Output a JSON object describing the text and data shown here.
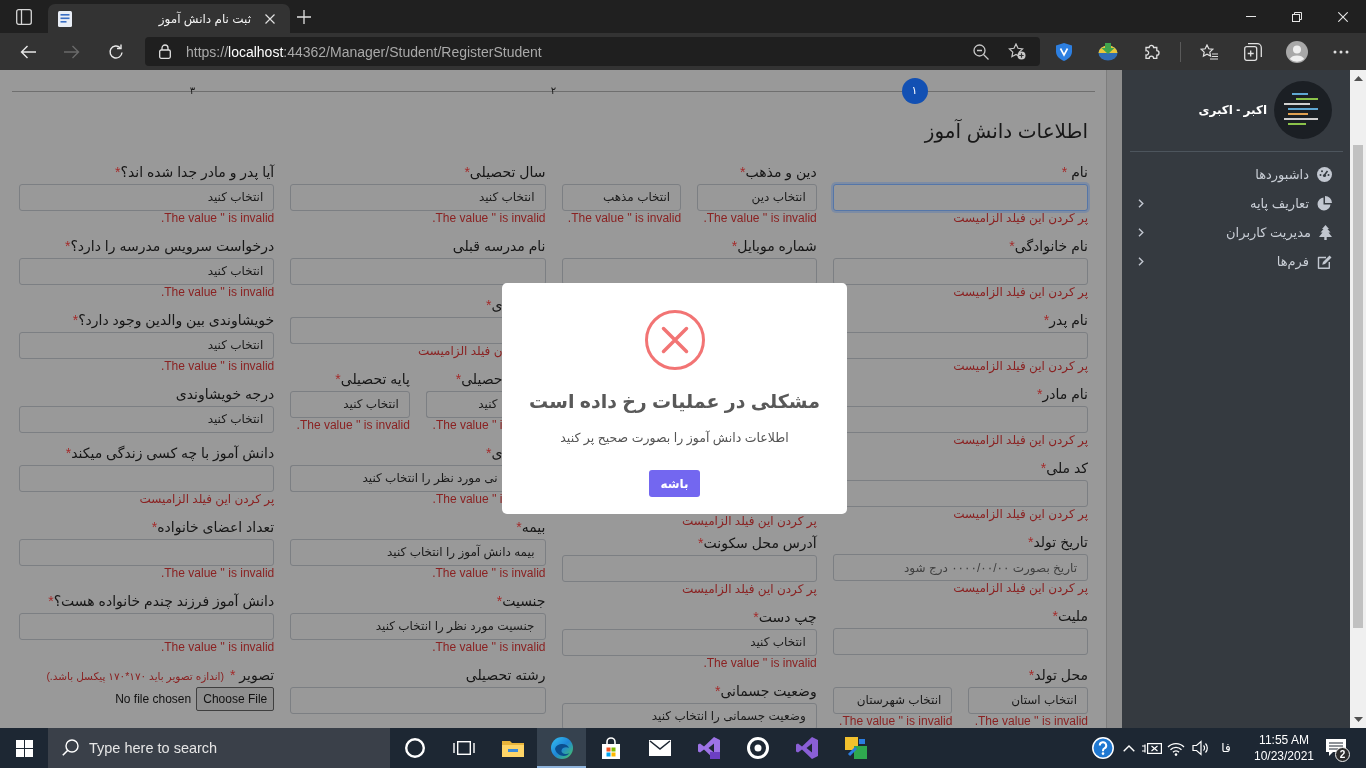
{
  "browser": {
    "tab": {
      "title": "ثبت نام دانش آموز",
      "selected": true
    },
    "back_button": {
      "disabled": false
    },
    "forward_button": {
      "disabled": true
    },
    "address": "https://**localhost**:44362/Manager/Student/RegisterStudent"
  },
  "form": {
    "steps": [
      {
        "label": "۱",
        "selected": true
      },
      {
        "label": "۲",
        "selected": false
      },
      {
        "label": "۳",
        "selected": false
      }
    ],
    "title": "اطلاعات دانش آموز",
    "columns": [
      [
        {
          "kind": "text",
          "label": "نام",
          "required_mark": " *",
          "focused": true,
          "error": "پر کردن این فیلد الزامیست"
        },
        {
          "kind": "text",
          "label": "نام خانوادگی",
          "required_mark": "*",
          "focused": false,
          "error": "پر کردن این فیلد الزامیست"
        },
        {
          "kind": "text",
          "label": "نام پدر",
          "required_mark": "*",
          "focused": false,
          "error": "پر کردن این فیلد الزامیست"
        },
        {
          "kind": "text",
          "label": "نام مادر",
          "required_mark": "*",
          "focused": false,
          "error": "پر کردن این فیلد الزامیست"
        },
        {
          "kind": "text",
          "label": "کد ملی",
          "required_mark": "*",
          "focused": false,
          "error": "پر کردن این فیلد الزامیست"
        },
        {
          "kind": "text",
          "label": "تاریخ تولد",
          "required_mark": "*",
          "focused": false,
          "placeholder": "تاریخ بصورت ۰۰۰۰/۰۰/۰۰ درج شود",
          "error": "پر کردن این فیلد الزامیست"
        },
        {
          "kind": "text",
          "label": "ملیت",
          "required_mark": "*",
          "focused": false
        },
        {
          "kind": "select_pair",
          "label": "محل تولد",
          "required_mark": "*",
          "selects": [
            {
              "value": "انتخاب استان",
              "error": "The value '' is invalid."
            },
            {
              "value": "انتخاب شهرستان",
              "error": "The value '' is invalid."
            }
          ]
        }
      ],
      [
        {
          "kind": "select_pair",
          "label": "دین و مذهب",
          "required_mark": "*",
          "selects": [
            {
              "value": "انتخاب دین",
              "error": "The value '' is invalid."
            },
            {
              "value": "انتخاب مذهب",
              "error": "The value '' is invalid."
            }
          ]
        },
        {
          "kind": "text",
          "label": "شماره موبایل",
          "required_mark": "*",
          "focused": false
        },
        {
          "kind": "error",
          "error": "پر کردن این فیلد الزامیست"
        },
        {
          "kind": "text",
          "label": "آدرس محل سکونت",
          "required_mark": "*",
          "focused": false,
          "error": "پر کردن این فیلد الزامیست"
        },
        {
          "kind": "select",
          "label": "چپ دست",
          "required_mark": "*",
          "value": "انتخاب کنید",
          "error": "The value '' is invalid."
        },
        {
          "kind": "select",
          "label": "وضعیت جسمانی",
          "required_mark": "*",
          "value": "وضعیت جسمانی را انتخاب کنید"
        }
      ],
      [
        {
          "kind": "select",
          "label": "سال تحصیلی",
          "required_mark": "*",
          "value": "انتخاب کنید",
          "error": "The value '' is invalid.",
          "partly_hidden": false
        },
        {
          "kind": "text",
          "label": "نام مدرسه قبلی",
          "focused": false,
          "partly_hidden": false
        },
        {
          "kind": "text",
          "label": "ی",
          "required_mark": "*",
          "focused": false,
          "error": "ن فیلد الزامیست",
          "partly_hidden": true
        },
        {
          "kind": "split",
          "parts": [
            {
              "label": "حصیلی",
              "required_mark": "*",
              "value": "کنید",
              "error": "The value '' i.",
              "partly_hidden": true
            },
            {
              "label": "پایه تحصیلی",
              "required_mark": "*",
              "value": "انتخاب کنید",
              "error": "The value '' is invalid.",
              "partly_hidden": false
            }
          ]
        },
        {
          "kind": "select",
          "label": "ی",
          "required_mark": "*",
          "value": "نی مورد نظر را انتخاب کنید",
          "error": "The value '' i.",
          "partly_hidden": true
        },
        {
          "kind": "select",
          "label": "بیمه",
          "required_mark": "*",
          "value": "بیمه دانش آموز را انتخاب کنید",
          "error": "The value '' is invalid.",
          "partly_hidden": false
        },
        {
          "kind": "select",
          "label": "جنسیت",
          "required_mark": "*",
          "value": "جنسیت مورد نظر را انتخاب کنید",
          "error": "The value '' is invalid.",
          "partly_hidden": false
        },
        {
          "kind": "text",
          "label": "رشته تحصیلی",
          "focused": false,
          "partly_hidden": false
        }
      ],
      [
        {
          "kind": "select",
          "label": "آیا پدر و مادر جدا شده اند؟",
          "required_mark": "*",
          "value": "انتخاب کنید",
          "error": "The value '' is invalid."
        },
        {
          "kind": "select",
          "label": "درخواست سرویس مدرسه را دارد؟",
          "required_mark": "*",
          "value": "انتخاب کنید",
          "error": "The value '' is invalid."
        },
        {
          "kind": "select",
          "label": "خویشاوندی بین والدین وجود دارد؟",
          "required_mark": "*",
          "value": "انتخاب کنید",
          "error": "The value '' is invalid."
        },
        {
          "kind": "select",
          "label": "درجه خویشاوندی",
          "value": "انتخاب کنید"
        },
        {
          "kind": "text",
          "label": "دانش آموز با چه کسی زندگی میکند",
          "required_mark": "*",
          "focused": false,
          "error": "پر کردن این فیلد الزامیست"
        },
        {
          "kind": "text",
          "label": "تعداد اعضای خانواده",
          "required_mark": "*",
          "focused": false,
          "error": "The value '' is invalid."
        },
        {
          "kind": "text",
          "label": "دانش آموز فرزند چندم خانواده هست؟",
          "required_mark": "*",
          "focused": false,
          "error": "The value '' is invalid."
        },
        {
          "kind": "file",
          "label": "تصویر",
          "required_mark": " *",
          "note": "(اندازه تصویر باید ۱۷۰*۱۷۰ پیکسل باشد.)",
          "button": "Choose File",
          "status": "No file chosen"
        }
      ]
    ]
  },
  "dialog": {
    "title": "مشکلی در عملیات رخ داده است",
    "message": "اطلاعات دانش آموز را بصورت صحیح پر کنید",
    "button": "باشه"
  },
  "sidebar": {
    "user_name": "اکبر - اکبری",
    "items": [
      {
        "label": "داشبوردها",
        "has_submenu": false
      },
      {
        "label": "تعاریف پایه",
        "has_submenu": true
      },
      {
        "label": "مدیریت کاربران",
        "has_submenu": true
      },
      {
        "label": "فرم‌ها",
        "has_submenu": true
      }
    ]
  },
  "taskbar": {
    "search": {
      "placeholder": "Type here to search"
    },
    "apps": [
      {
        "selected": false
      },
      {
        "selected": false
      },
      {
        "selected": false
      },
      {
        "selected": true
      },
      {
        "selected": false
      },
      {
        "selected": false
      },
      {
        "selected": false
      },
      {
        "selected": false
      },
      {
        "selected": false
      },
      {
        "selected": false
      }
    ],
    "language": "فا",
    "time": "11:55 AM",
    "date": "10/23/2021",
    "notification_count": "2"
  }
}
